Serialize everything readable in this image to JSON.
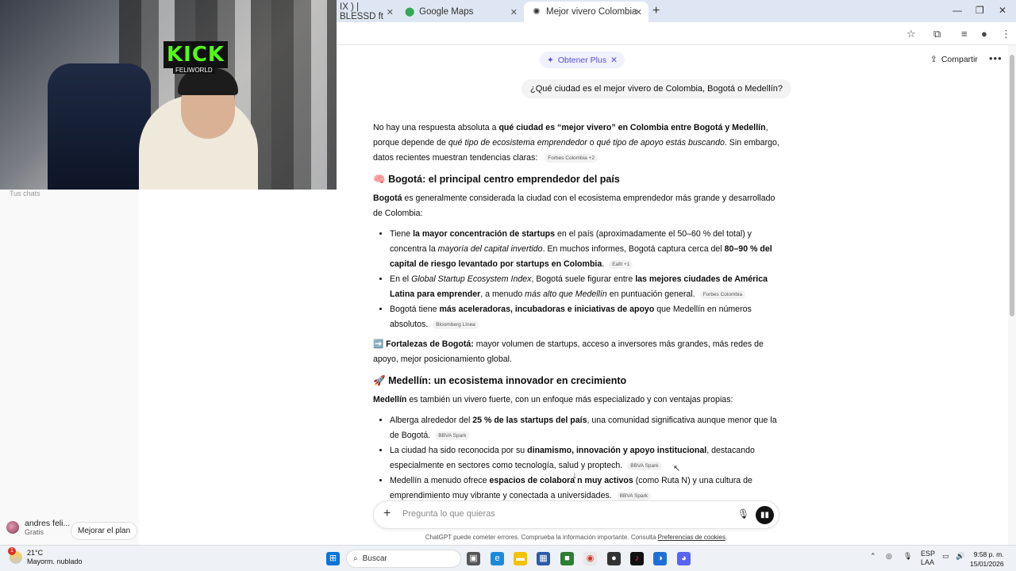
{
  "browser": {
    "tabs": [
      {
        "label": "IX ) | BLESSD ft",
        "icon": "youtube-icon"
      },
      {
        "label": "Google Maps",
        "icon": "maps-pin-icon"
      },
      {
        "label": "Mejor vivero Colombia",
        "icon": "chatgpt-icon",
        "active": true
      }
    ],
    "colors": {
      "tabstrip": "#dfe6f3"
    }
  },
  "webcam": {
    "overlay_text": "KICK",
    "overlay_sub": "FELIWORLD"
  },
  "sidebar": {
    "faded_text": "Tus chats",
    "user_name": "andres feli...",
    "user_plan": "Gratis",
    "upgrade_label": "Mejorar el plan"
  },
  "header": {
    "plus_label": "Obtener Plus",
    "share_label": "Compartir"
  },
  "chat": {
    "user_message": "¿Qué ciudad es el mejor vivero de Colombia, Bogotá o Medellín?",
    "intro": {
      "a": "No hay una respuesta absoluta a ",
      "b": "qué ciudad es “mejor vivero” en Colombia entre Bogotá y Medellín",
      "c": ", porque depende de ",
      "d": "qué tipo de ecosistema emprendedor",
      "e": " o ",
      "f": "qué tipo de apoyo estás buscando",
      "g": ". Sin embargo, datos recientes muestran tendencias claras:",
      "src": "Forbes Colombia +2"
    },
    "bogota": {
      "emoji": "🧠",
      "heading": "Bogotá: el principal centro emprendedor del país",
      "lead_bold": "Bogotá",
      "lead": " es generalmente considerada la ciudad con el ecosistema emprendedor más grande y desarrollado de Colombia:",
      "b1": {
        "a": "Tiene ",
        "b": "la mayor concentración de startups",
        "c": " en el país (aproximadamente el 50–60 % del total) y concentra la ",
        "d": "mayoría del capital invertido",
        "e": ". En muchos informes, Bogotá captura cerca del ",
        "f": "80–90 % del capital de riesgo levantado por startups en Colombia",
        "g": ".",
        "src": "Eafit +1"
      },
      "b2": {
        "a": "En el ",
        "b": "Global Startup Ecosystem Index",
        "c": ", Bogotá suele figurar entre ",
        "d": "las mejores ciudades de América Latina para emprender",
        "e": ", a menudo ",
        "f": "más alto que Medellín",
        "g": " en puntuación general.",
        "src": "Forbes Colombia"
      },
      "b3": {
        "a": "Bogotá tiene ",
        "b": "más aceleradoras, incubadoras e iniciativas de apoyo",
        "c": " que Medellín en números absolutos.",
        "src": "Bloomberg Línea"
      },
      "strengths_emoji": "➡️",
      "strengths_label": "Fortalezas de Bogotá:",
      "strengths": " mayor volumen de startups, acceso a inversores más grandes, más redes de apoyo, mejor posicionamiento global."
    },
    "medellin": {
      "emoji": "🚀",
      "heading": "Medellín: un ecosistema innovador en crecimiento",
      "lead_bold": "Medellín",
      "lead": " es también un vivero fuerte, con un enfoque más especializado y con ventajas propias:",
      "b1": {
        "a": "Alberga alrededor del ",
        "b": "25 % de las startups del país",
        "c": ", una comunidad significativa aunque menor que la de Bogotá.",
        "src": "BBVA Spark"
      },
      "b2": {
        "a": "La ciudad ha sido reconocida por su ",
        "b": "dinamismo, innovación y apoyo institucional",
        "c": ", destacando especialmente en sectores como tecnología, salud y proptech.",
        "src": "BBVA Spark"
      },
      "b3": {
        "a": "Medellín a menudo ofrece ",
        "b": "espacios de colabora   n muy activos",
        "c": " (como Ruta N) y una cultura de emprendimiento muy vibrante y conectada a universidades.",
        "src": "BBVA Spark"
      }
    }
  },
  "composer": {
    "placeholder": "Pregunta lo que quieras",
    "disclaimer": "ChatGPT puede cometer errores. Comprueba la información importante. Consulta ",
    "disclaimer_link": "Preferencias de cookies",
    "disclaimer_end": "."
  },
  "taskbar": {
    "weather_temp": "21°C",
    "weather_desc": "Mayorm. nublado",
    "weather_badge": "1",
    "search_label": "Buscar",
    "lang_top": "ESP",
    "lang_bottom": "LAA",
    "time": "9:58 p. m.",
    "date": "15/01/2026"
  }
}
